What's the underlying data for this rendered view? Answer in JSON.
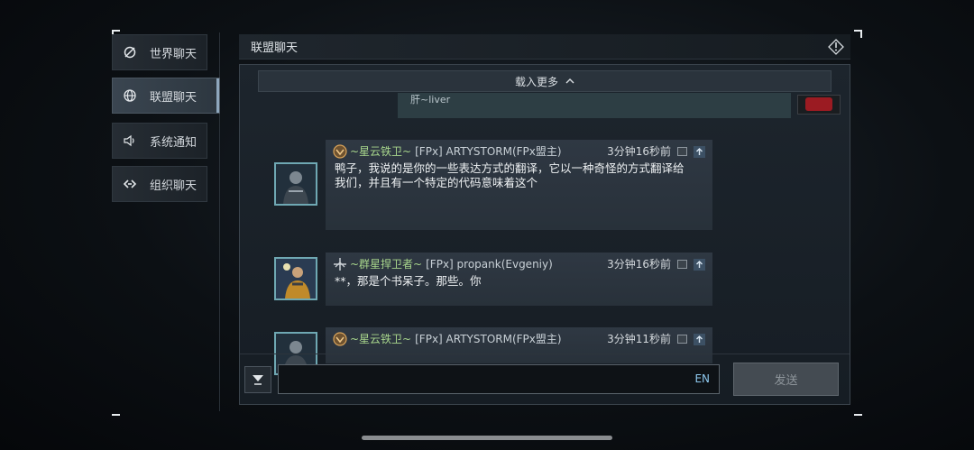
{
  "tabs": [
    {
      "label": "世界聊天",
      "icon": "world-chat-icon",
      "active": false
    },
    {
      "label": "联盟聊天",
      "icon": "globe-icon",
      "active": true
    },
    {
      "label": "系统通知",
      "icon": "speaker-icon",
      "active": false
    },
    {
      "label": "组织聊天",
      "icon": "link-icon",
      "active": false
    }
  ],
  "header": {
    "title": "联盟聊天",
    "pin_icon": "pin-icon"
  },
  "chat": {
    "load_more": "载入更多",
    "partial_text": "肝~liver",
    "messages": [
      {
        "group": "~星云铁卫~",
        "name": "[FPx] ARTYSTORM(FPx盟主)",
        "time": "3分钟16秒前",
        "text": "鸭子，我说的是你的一些表达方式的翻译，它以一种奇怪的方式翻译给我们，并且有一个特定的代码意味着这个"
      },
      {
        "group": "~群星捍卫者~",
        "name": "[FPx] propank(Evgeniy)",
        "time": "3分钟16秒前",
        "text": "**，那是个书呆子。那些。你"
      },
      {
        "group": "~星云铁卫~",
        "name": "[FPx] ARTYSTORM(FPx盟主)",
        "time": "3分钟11秒前",
        "text": ""
      }
    ]
  },
  "input": {
    "lang": "EN",
    "send_label": "发送",
    "value": ""
  },
  "colors": {
    "group_name": "#a8d68c",
    "accent": "#8ea7bd"
  }
}
